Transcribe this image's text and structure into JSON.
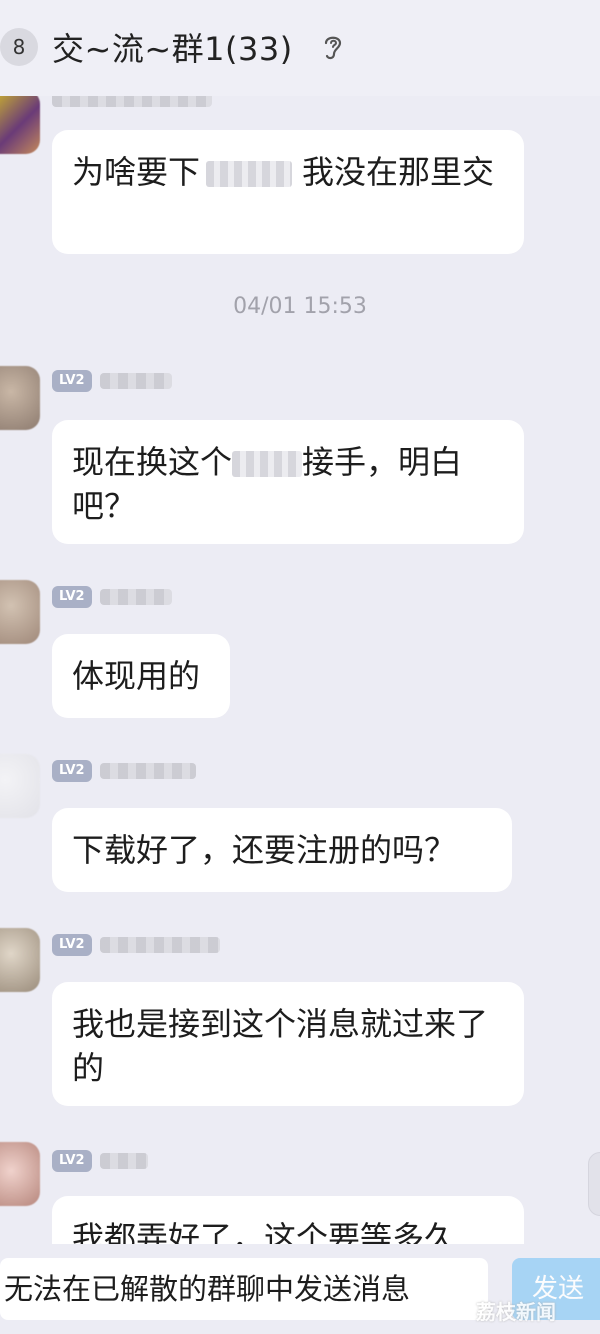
{
  "header": {
    "unread_count": "8",
    "title": "交~流~群1(33)",
    "icons": [
      "back-badge",
      "ear-icon"
    ]
  },
  "messages": [
    {
      "text_a": "为啥要下",
      "text_b": "我没在那里交",
      "level": ""
    },
    {
      "text_a": "现在换这个",
      "text_b": "接手，明白吧？",
      "level": "LV2"
    },
    {
      "text": "体现用的",
      "level": "LV2"
    },
    {
      "text": "下载好了，还要注册的吗？",
      "level": "LV2"
    },
    {
      "text": "我也是接到这个消息就过来了的",
      "level": "LV2"
    },
    {
      "text": "我都弄好了，这个要等多久",
      "level": "LV2"
    }
  ],
  "timestamp": "04/01 15:53",
  "footer": {
    "input_text": "无法在已解散的群聊中发送消息",
    "send_label": "发送"
  },
  "watermark": "荔枝新闻",
  "colors": {
    "background": "#ececf4",
    "bubble": "#ffffff",
    "level_badge": "#a9b0c6",
    "send_button": "#9bd0f5"
  }
}
